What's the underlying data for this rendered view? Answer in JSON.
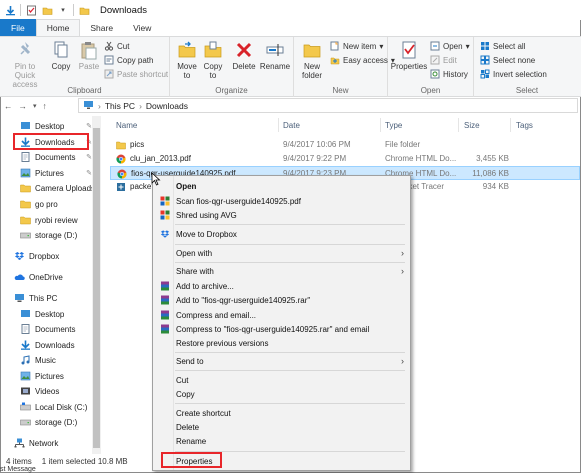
{
  "window": {
    "title": "Downloads"
  },
  "ribbon_tabs": [
    {
      "label": "File"
    },
    {
      "label": "Home"
    },
    {
      "label": "Share"
    },
    {
      "label": "View"
    }
  ],
  "ribbon": {
    "clipboard": {
      "pin_label": "Pin to Quick access",
      "copy_label": "Copy",
      "paste_label": "Paste",
      "cut_label": "Cut",
      "copy_path_label": "Copy path",
      "paste_shortcut_label": "Paste shortcut",
      "group_label": "Clipboard"
    },
    "organize": {
      "move_to_label": "Move to",
      "copy_to_label": "Copy to",
      "delete_label": "Delete",
      "rename_label": "Rename",
      "group_label": "Organize"
    },
    "new": {
      "new_folder_label": "New folder",
      "new_item_label": "New item",
      "easy_access_label": "Easy access",
      "group_label": "New"
    },
    "open": {
      "properties_label": "Properties",
      "open_label": "Open",
      "edit_label": "Edit",
      "history_label": "History",
      "group_label": "Open"
    },
    "select": {
      "select_all_label": "Select all",
      "select_none_label": "Select none",
      "invert_label": "Invert selection",
      "group_label": "Select"
    }
  },
  "address": {
    "path_root": "This PC",
    "path_leaf": "Downloads"
  },
  "nav": {
    "items": [
      {
        "label": "Desktop"
      },
      {
        "label": "Downloads"
      },
      {
        "label": "Documents"
      },
      {
        "label": "Pictures"
      },
      {
        "label": "Camera Uploads"
      },
      {
        "label": "go pro"
      },
      {
        "label": "ryobi review"
      },
      {
        "label": "storage (D:)"
      },
      {
        "label": "Dropbox"
      },
      {
        "label": "OneDrive"
      },
      {
        "label": "This PC"
      },
      {
        "label": "Desktop"
      },
      {
        "label": "Documents"
      },
      {
        "label": "Downloads"
      },
      {
        "label": "Music"
      },
      {
        "label": "Pictures"
      },
      {
        "label": "Videos"
      },
      {
        "label": "Local Disk (C:)"
      },
      {
        "label": "storage (D:)"
      },
      {
        "label": "Network"
      }
    ]
  },
  "columns": {
    "name": "Name",
    "date": "Date",
    "type": "Type",
    "size": "Size",
    "tags": "Tags"
  },
  "files": [
    {
      "name": "pics",
      "date": "9/4/2017 10:06 PM",
      "type": "File folder",
      "size": ""
    },
    {
      "name": "clu_jan_2013.pdf",
      "date": "9/4/2017 9:22 PM",
      "type": "Chrome HTML Do...",
      "size": "3,455 KB"
    },
    {
      "name": "fios-qgr-userguide140925.pdf",
      "date": "9/4/2017 9:23 PM",
      "type": "Chrome HTML Do...",
      "size": "11,086 KB"
    },
    {
      "name": "packet",
      "date": "",
      "type": "acket Tracer",
      "size": "934 KB"
    }
  ],
  "status": {
    "count": "4 items",
    "selection": "1 item selected  10.8 MB",
    "bottom_text": "st Message"
  },
  "context_menu": {
    "items": [
      {
        "label": "Open",
        "bold": true
      },
      {
        "label": "Scan fios-qgr-userguide140925.pdf"
      },
      {
        "label": "Shred using AVG"
      },
      {
        "label": "Move to Dropbox"
      },
      {
        "label": "Open with"
      },
      {
        "label": "Share with"
      },
      {
        "label": "Add to archive..."
      },
      {
        "label": "Add to \"fios-qgr-userguide140925.rar\""
      },
      {
        "label": "Compress and email..."
      },
      {
        "label": "Compress to \"fios-qgr-userguide140925.rar\" and email"
      },
      {
        "label": "Restore previous versions"
      },
      {
        "label": "Send to"
      },
      {
        "label": "Cut"
      },
      {
        "label": "Copy"
      },
      {
        "label": "Create shortcut"
      },
      {
        "label": "Delete"
      },
      {
        "label": "Rename"
      },
      {
        "label": "Properties"
      }
    ]
  },
  "colors": {
    "accent": "#1979ca",
    "highlight": "#e8262a",
    "selection": "#cce8ff"
  }
}
